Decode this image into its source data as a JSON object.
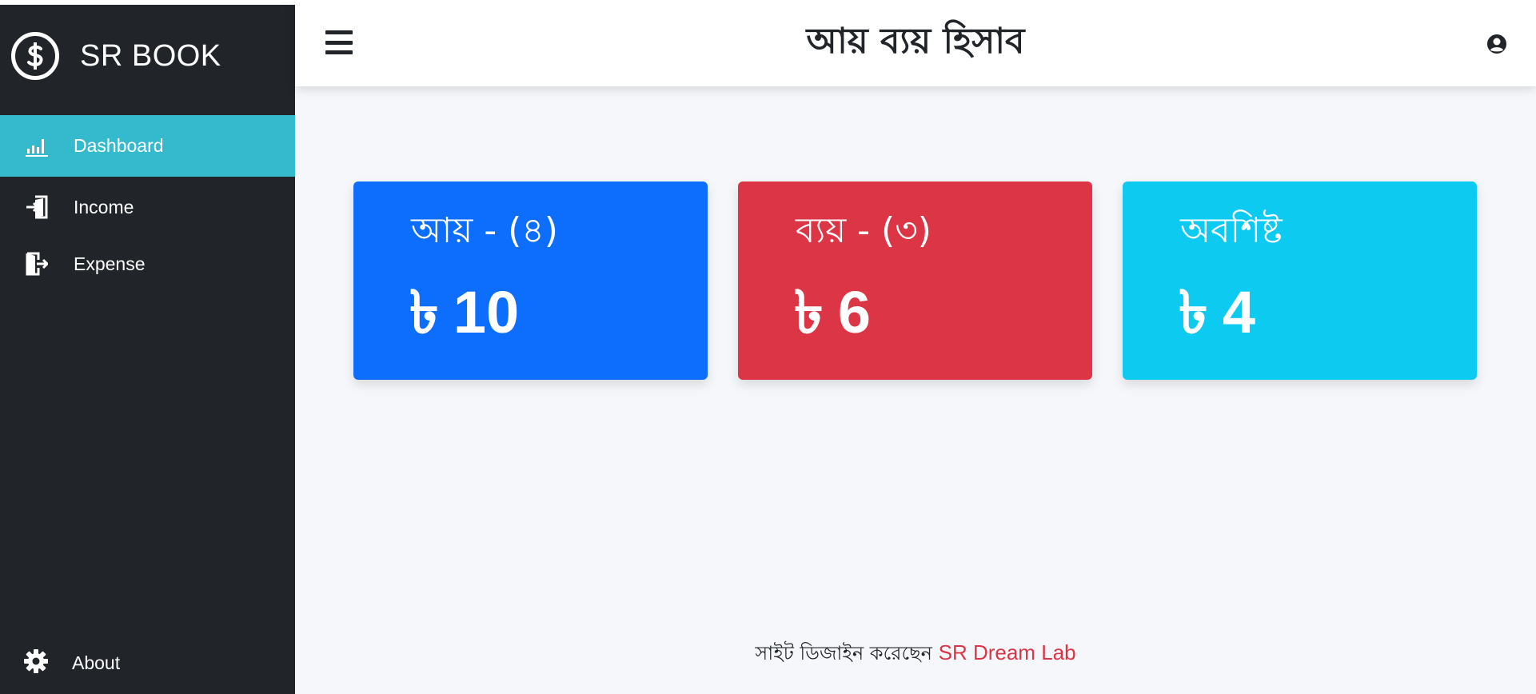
{
  "brand": {
    "name": "SR BOOK",
    "logo_icon": "dollar-circle-icon"
  },
  "sidebar": {
    "items": [
      {
        "label": "Dashboard",
        "icon": "chart-bar-icon",
        "active": true
      },
      {
        "label": "Income",
        "icon": "sign-in-icon",
        "active": false
      },
      {
        "label": "Expense",
        "icon": "sign-out-icon",
        "active": false
      }
    ],
    "about": {
      "label": "About",
      "icon": "gear-icon"
    }
  },
  "header": {
    "title": "আয় ব্যয় হিসাব",
    "menu_icon": "hamburger-icon",
    "user_icon": "user-circle-icon"
  },
  "cards": {
    "income": {
      "title": "আয় - (৪)",
      "currency": "৳",
      "amount": "10",
      "color": "#0d6efd"
    },
    "expense": {
      "title": "ব্যয় - (৩)",
      "currency": "৳",
      "amount": "6",
      "color": "#dc3545"
    },
    "balance": {
      "title": "অবশিষ্ট",
      "currency": "৳",
      "amount": "4",
      "color": "#0dcaf0"
    }
  },
  "footer": {
    "text": "সাইট ডিজাইন করেছেন",
    "link_text": "SR Dream Lab"
  },
  "colors": {
    "sidebar_bg": "#212529",
    "active_item": "#35bacd",
    "page_bg": "#f5f7fb"
  }
}
